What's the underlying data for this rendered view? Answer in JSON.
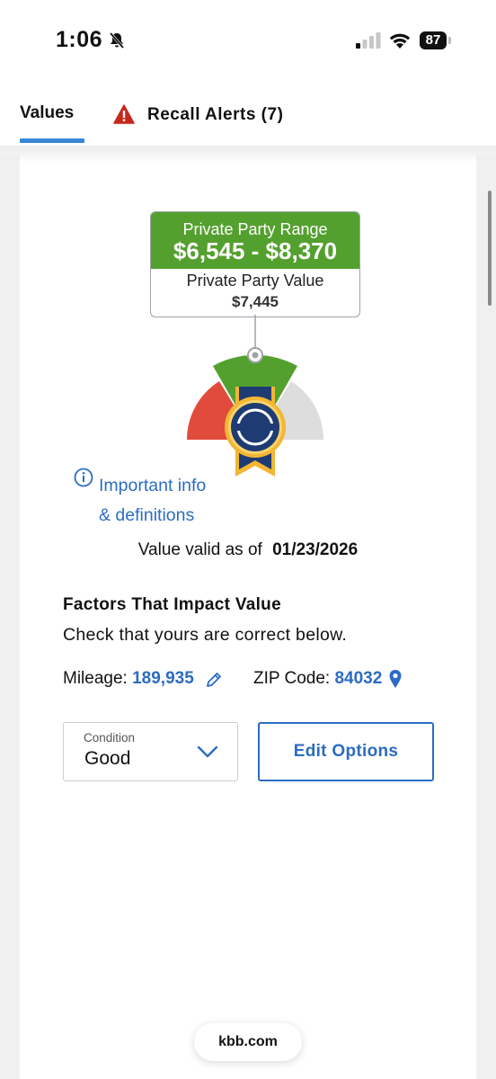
{
  "status_bar": {
    "time": "1:06",
    "battery": "87"
  },
  "tabs": [
    {
      "label": "Values",
      "active": true
    },
    {
      "label": "Recall Alerts (7)",
      "active": false
    }
  ],
  "price": {
    "range_label": "Private Party Range",
    "range_value": "$6,545 - $8,370",
    "value_label": "Private Party Value",
    "value": "$7,445"
  },
  "info_link": {
    "line1": "Important info",
    "line2": "& definitions"
  },
  "valid": {
    "label": "Value valid as of",
    "date": "01/23/2026"
  },
  "factors": {
    "title": "Factors That Impact Value",
    "subtitle": "Check that yours are correct below.",
    "mileage_label": "Mileage:",
    "mileage_value": "189,935",
    "zip_label": "ZIP Code:",
    "zip_value": "84032"
  },
  "condition": {
    "label": "Condition",
    "value": "Good"
  },
  "edit_button": "Edit Options",
  "browser_url": "kbb.com",
  "colors": {
    "green": "#54a02f",
    "blue": "#2b6cc4",
    "red": "#e14b3b",
    "navy": "#1f3b73",
    "gold": "#f2b635"
  },
  "icons": [
    "bell-off-icon",
    "signal-icon",
    "wifi-icon",
    "battery-icon",
    "warning-icon",
    "info-icon",
    "pencil-icon",
    "location-pin-icon",
    "chevron-down-icon",
    "kbb-ribbon-icon"
  ]
}
